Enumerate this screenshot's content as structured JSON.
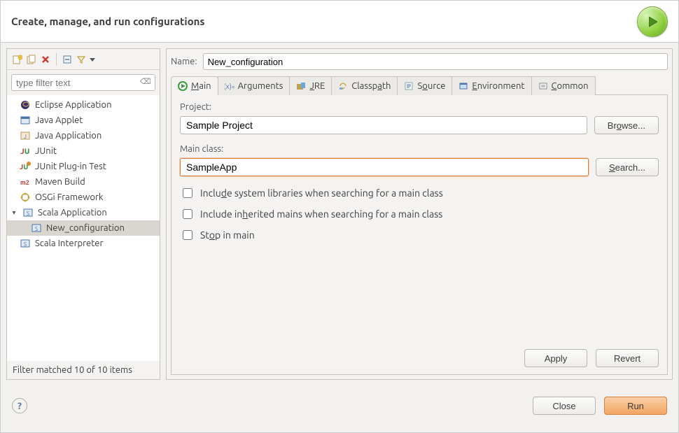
{
  "header": {
    "title": "Create, manage, and run configurations"
  },
  "left": {
    "filter_placeholder": "type filter text",
    "status": "Filter matched 10 of 10 items",
    "items": [
      {
        "label": "Eclipse Application",
        "icon": "eclipse"
      },
      {
        "label": "Java Applet",
        "icon": "applet"
      },
      {
        "label": "Java Application",
        "icon": "java"
      },
      {
        "label": "JUnit",
        "icon": "junit"
      },
      {
        "label": "JUnit Plug-in Test",
        "icon": "junitplug"
      },
      {
        "label": "Maven Build",
        "icon": "maven"
      },
      {
        "label": "OSGi Framework",
        "icon": "osgi"
      },
      {
        "label": "Scala Application",
        "icon": "scala",
        "expandable": true,
        "expanded": true
      },
      {
        "label": "New_configuration",
        "icon": "scala",
        "child": true,
        "selected": true
      },
      {
        "label": "Scala Interpreter",
        "icon": "scala"
      }
    ]
  },
  "right": {
    "name_label": "Name:",
    "name_value": "New_configuration",
    "tabs": [
      {
        "label_html": "<u>M</u>ain",
        "icon": "main",
        "active": true
      },
      {
        "label_html": "Ar<u>g</u>uments",
        "icon": "args"
      },
      {
        "label_html": "<u>J</u>RE",
        "icon": "jre"
      },
      {
        "label_html": "Classp<u>a</u>th",
        "icon": "classpath"
      },
      {
        "label_html": "S<u>o</u>urce",
        "icon": "source"
      },
      {
        "label_html": "<u>E</u>nvironment",
        "icon": "env"
      },
      {
        "label_html": "<u>C</u>ommon",
        "icon": "common"
      }
    ],
    "main": {
      "project_label": "Project:",
      "project_value": "Sample Project",
      "browse_label": "Browse...",
      "mainclass_label": "Main class:",
      "mainclass_value": "SampleApp",
      "search_label": "Search...",
      "cb1": "Include system libraries when searching for a main class",
      "cb2": "Include inherited mains when searching for a main class",
      "cb3": "Stop in main",
      "apply": "Apply",
      "revert": "Revert"
    }
  },
  "footer": {
    "close": "Close",
    "run": "Run"
  }
}
